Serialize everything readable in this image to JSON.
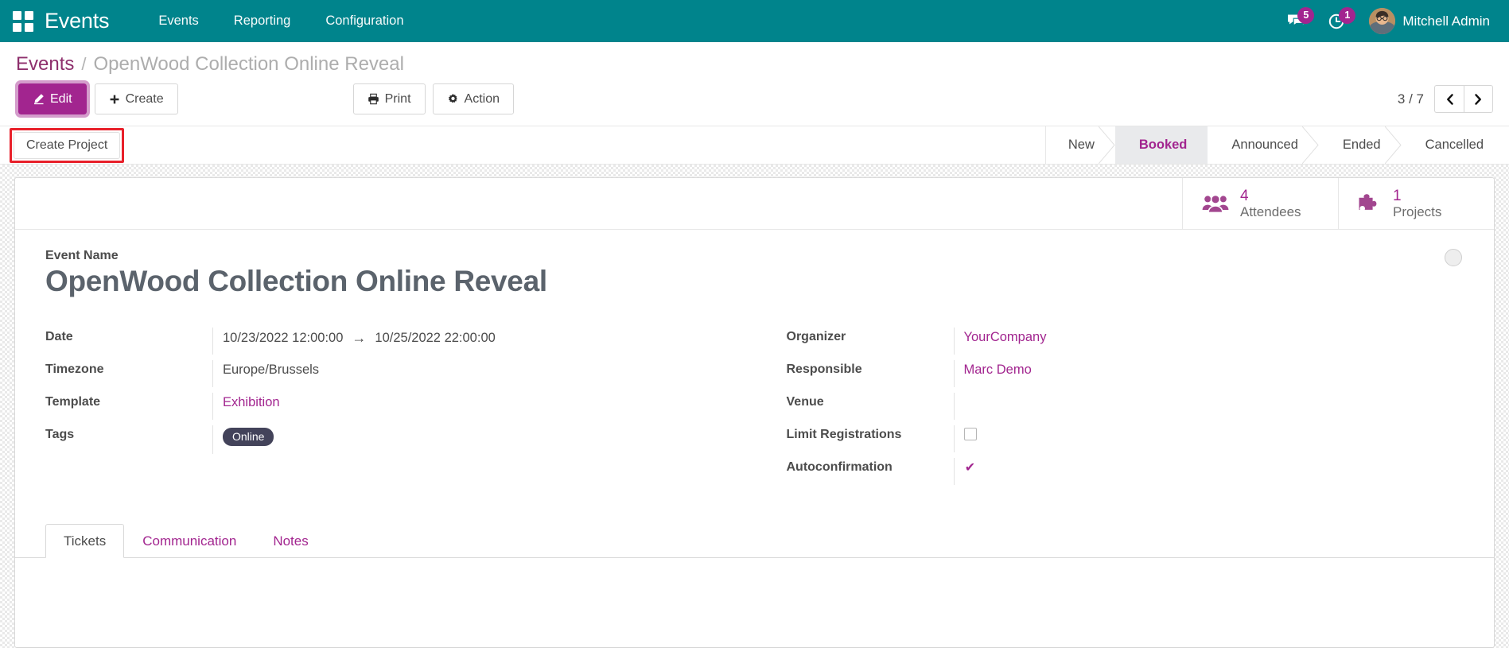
{
  "navbar": {
    "apps_icon": "apps-grid-icon",
    "brand": "Events",
    "menu": [
      {
        "label": "Events"
      },
      {
        "label": "Reporting"
      },
      {
        "label": "Configuration"
      }
    ],
    "messages_icon": "chat-bubble-icon",
    "messages_count": "5",
    "activities_icon": "clock-activity-icon",
    "activities_count": "1",
    "user_name": "Mitchell Admin",
    "accent_color": "#00848c"
  },
  "breadcrumb": {
    "root": "Events",
    "separator": "/",
    "current": "OpenWood Collection Online Reveal"
  },
  "toolbar": {
    "edit_label": "Edit",
    "edit_icon": "pencil-icon",
    "create_label": "Create",
    "create_icon": "plus-icon",
    "print_label": "Print",
    "print_icon": "printer-icon",
    "action_label": "Action",
    "action_icon": "gear-icon",
    "pager_counter": "3 / 7",
    "pager_prev_icon": "chevron-left-icon",
    "pager_next_icon": "chevron-right-icon",
    "primary_color": "#a2258f"
  },
  "statusbar": {
    "create_project_label": "Create Project",
    "highlight_color": "#e8202a",
    "stages": [
      {
        "label": "New",
        "active": false
      },
      {
        "label": "Booked",
        "active": true
      },
      {
        "label": "Announced",
        "active": false
      },
      {
        "label": "Ended",
        "active": false
      },
      {
        "label": "Cancelled",
        "active": false
      }
    ]
  },
  "smart_buttons": [
    {
      "icon": "users-group-icon",
      "value": "4",
      "label": "Attendees"
    },
    {
      "icon": "puzzle-piece-icon",
      "value": "1",
      "label": "Projects"
    }
  ],
  "form": {
    "event_name_label": "Event Name",
    "event_name_value": "OpenWood Collection Online Reveal",
    "favorite_icon": "star-circle-icon",
    "left_fields": [
      {
        "label": "Date",
        "value_start": "10/23/2022 12:00:00",
        "arrow": "→",
        "value_end": "10/25/2022 22:00:00",
        "type": "daterange"
      },
      {
        "label": "Timezone",
        "value": "Europe/Brussels",
        "type": "text"
      },
      {
        "label": "Template",
        "value": "Exhibition",
        "type": "link"
      },
      {
        "label": "Tags",
        "value": "Online",
        "type": "tag"
      }
    ],
    "right_fields": [
      {
        "label": "Organizer",
        "value": "YourCompany",
        "type": "link"
      },
      {
        "label": "Responsible",
        "value": "Marc Demo",
        "type": "link"
      },
      {
        "label": "Venue",
        "value": "",
        "type": "text"
      },
      {
        "label": "Limit Registrations",
        "value": "",
        "type": "checkbox",
        "checked": false
      },
      {
        "label": "Autoconfirmation",
        "value": "✔",
        "type": "checkbox",
        "checked": true
      }
    ]
  },
  "notebook": {
    "tabs": [
      {
        "label": "Tickets",
        "active": true
      },
      {
        "label": "Communication",
        "active": false
      },
      {
        "label": "Notes",
        "active": false
      }
    ]
  }
}
